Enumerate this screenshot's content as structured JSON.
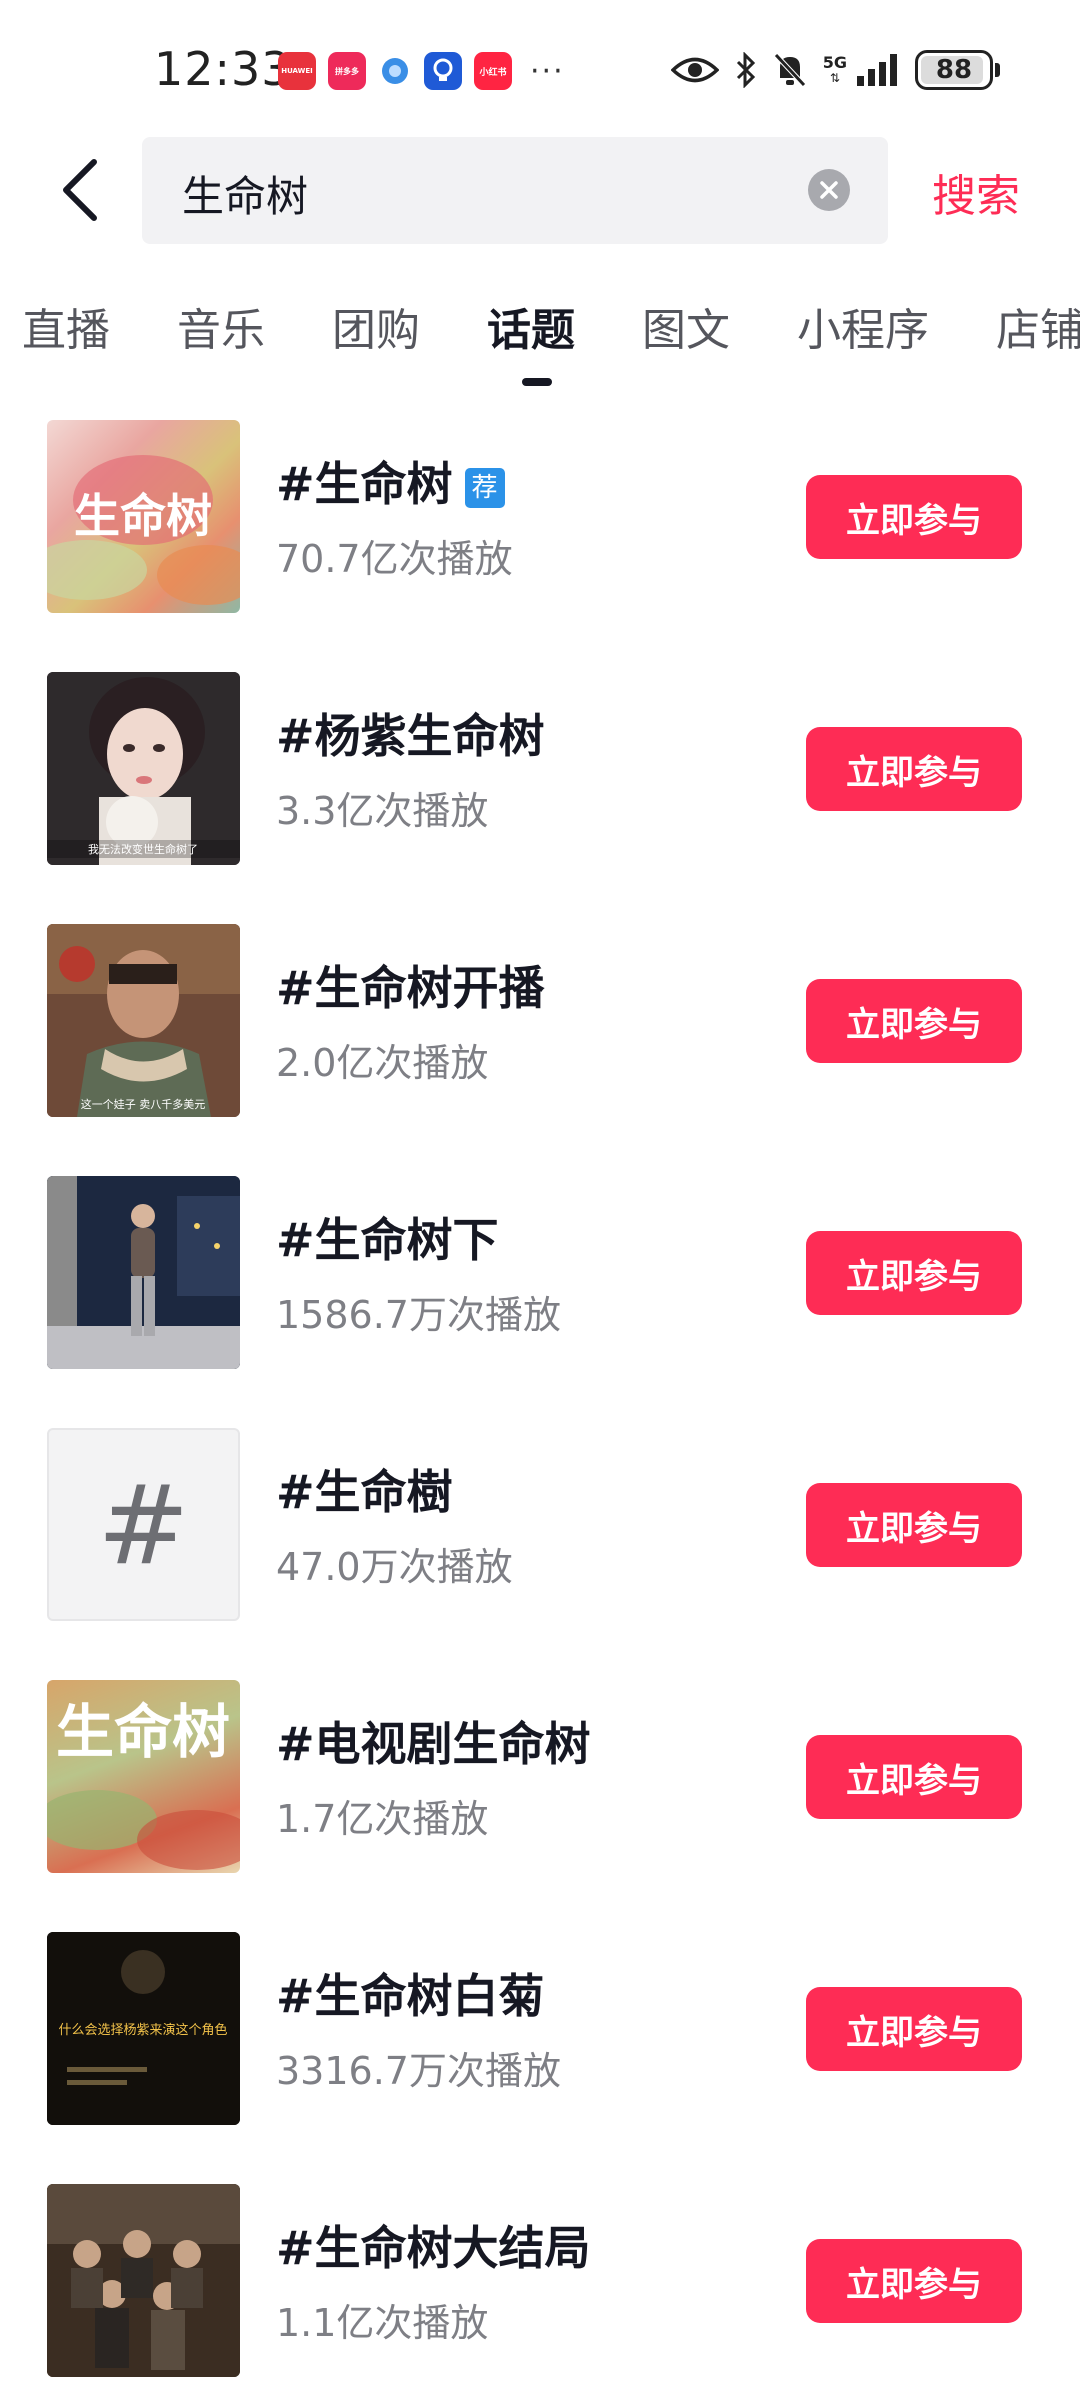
{
  "status_bar": {
    "time": "12:33",
    "app_icons": [
      {
        "name": "huawei-appgallery-icon",
        "label": "HUAWEI"
      },
      {
        "name": "pinduoduo-icon",
        "label": "拼多多"
      },
      {
        "name": "browser-icon",
        "label": ""
      },
      {
        "name": "tips-icon",
        "label": ""
      },
      {
        "name": "xiaohongshu-icon",
        "label": "小红书"
      }
    ],
    "more": "···",
    "network": "5G",
    "battery": "88"
  },
  "search": {
    "query": "生命树",
    "submit_label": "搜索"
  },
  "tabs": [
    {
      "label": "直播",
      "active": false
    },
    {
      "label": "音乐",
      "active": false
    },
    {
      "label": "团购",
      "active": false
    },
    {
      "label": "话题",
      "active": true
    },
    {
      "label": "图文",
      "active": false
    },
    {
      "label": "小程序",
      "active": false
    },
    {
      "label": "店铺",
      "active": false
    }
  ],
  "colors": {
    "accent": "#fe2c55",
    "badge": "#2b92e8"
  },
  "topics": [
    {
      "title": "#生命树",
      "badge": "荐",
      "count": "70.7亿次播放",
      "action": "立即参与",
      "thumb_text": "生命树"
    },
    {
      "title": "#杨紫生命树",
      "badge": "",
      "count": "3.3亿次播放",
      "action": "立即参与",
      "thumb_text": "我无法改变世生命树了"
    },
    {
      "title": "#生命树开播",
      "badge": "",
      "count": "2.0亿次播放",
      "action": "立即参与",
      "thumb_text": "这一个娃子 卖八千多美元"
    },
    {
      "title": "#生命树下",
      "badge": "",
      "count": "1586.7万次播放",
      "action": "立即参与",
      "thumb_text": ""
    },
    {
      "title": "#生命樹",
      "badge": "",
      "count": "47.0万次播放",
      "action": "立即参与",
      "thumb_text": "#"
    },
    {
      "title": "#电视剧生命树",
      "badge": "",
      "count": "1.7亿次播放",
      "action": "立即参与",
      "thumb_text": "生命树"
    },
    {
      "title": "#生命树白菊",
      "badge": "",
      "count": "3316.7万次播放",
      "action": "立即参与",
      "thumb_text": "什么会选择杨紫来演这个角色"
    },
    {
      "title": "#生命树大结局",
      "badge": "",
      "count": "1.1亿次播放",
      "action": "立即参与",
      "thumb_text": ""
    }
  ]
}
